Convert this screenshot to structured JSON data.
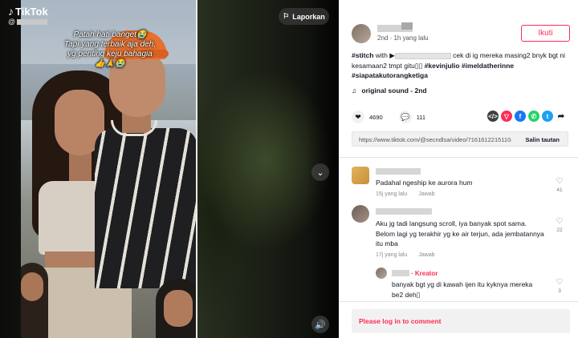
{
  "video": {
    "brand": "TikTok",
    "handle_prefix": "@",
    "caption_lines": [
      "Patah hati banget😭",
      "Tapi yang terbaik aja deh,",
      "yg penting keju bahagia",
      "👍🙏😭"
    ],
    "report_label": "Laporkan",
    "chevron_glyph": "⌄",
    "volume_glyph": "🔊"
  },
  "post": {
    "meta": "2nd · 1h yang lalu",
    "follow_label": "Ikuti",
    "desc_start": "#stitch",
    "desc_with": " with ",
    "desc_play": "▶",
    "desc_mid": " cek di ig mereka masing2 bnyk bgt ni kesamaan2 tmpt gitu",
    "desc_box": "▯▯",
    "hashtags": " #kevinjulio #imeldatherinne #siapatakutorangketiga",
    "sound_glyph": "♫",
    "sound": "original sound - 2nd",
    "likes": "4690",
    "comments": "111",
    "share_colors": {
      "embed": "#404040",
      "friends": "#fe2c55",
      "facebook": "#1877f2",
      "whatsapp": "#25d366",
      "twitter": "#1da1f2"
    },
    "link_url": "https://www.tiktok.com/@secndlsa/video/71616122151104...",
    "copy_label": "Salin tautan"
  },
  "comments": [
    {
      "text": "Padahal ngeship ke aurora hum",
      "time": "15j yang lalu",
      "reply": "Jawab",
      "likes": "41"
    },
    {
      "text": "Aku jg tadi langsung scroll, iya banyak spot sama. Belom lagi yg terakhir yg ke air terjun, ada jembatannya itu mba",
      "time": "17j yang lalu",
      "reply": "Jawab",
      "likes": "22"
    },
    {
      "badge": "· Kreator",
      "text": "banyak bgt yg di kawah ijen itu kyknya mereka be2 deh▯",
      "likes": "3"
    }
  ],
  "login": "Please log in to comment"
}
